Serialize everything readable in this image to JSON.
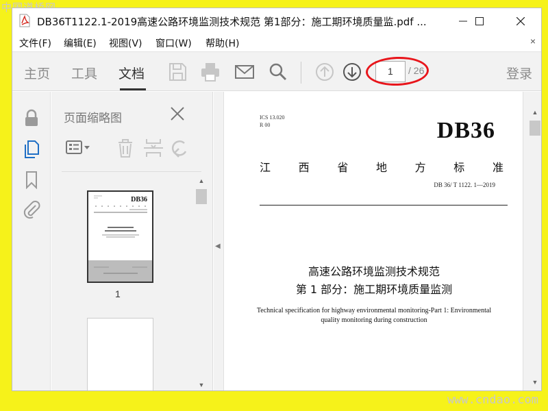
{
  "watermarks": {
    "top_left": "中国道桥网",
    "bottom_right": "www.cndao.com"
  },
  "window": {
    "title": "DB36T1122.1-2019高速公路环境监测技术规范 第1部分：施工期环境质量监.pdf ..."
  },
  "menu": {
    "items": [
      {
        "label": "文件(F)"
      },
      {
        "label": "编辑(E)"
      },
      {
        "label": "视图(V)"
      },
      {
        "label": "窗口(W)"
      },
      {
        "label": "帮助(H)"
      }
    ],
    "close": "×"
  },
  "toolbar": {
    "tabs": [
      {
        "label": "主页",
        "active": false
      },
      {
        "label": "工具",
        "active": false
      },
      {
        "label": "文档",
        "active": true
      }
    ],
    "icons": [
      "save-icon",
      "print-icon",
      "email-icon",
      "search-icon",
      "page-up-icon",
      "page-down-icon"
    ],
    "page_current": "1",
    "page_total": "/ 26",
    "login": "登录",
    "annotation_color": "#e8151b"
  },
  "left_rail": {
    "icons": [
      "lock-icon",
      "page-thumbnails-icon",
      "bookmark-icon",
      "attachment-icon"
    ]
  },
  "thumbnail_panel": {
    "title": "页面缩略图",
    "icons": [
      "options-menu-icon",
      "delete-icon",
      "extract-icon",
      "rotate-icon"
    ],
    "thumbnails": [
      {
        "label": "1"
      }
    ],
    "thumb_code": "DB36"
  },
  "document": {
    "ics": "ICS 13.020",
    "category": "R 00",
    "code": "DB36",
    "province_chars": [
      "江",
      "西",
      "省",
      "地",
      "方",
      "标",
      "准"
    ],
    "standard_number": "DB 36/ T 1122. 1—2019",
    "title_cn_line1": "高速公路环境监测技术规范",
    "title_cn_line2": "第 1 部分：施工期环境质量监测",
    "title_en": "Technical specification for highway environmental monitoring-Part 1: Environmental quality monitoring during construction"
  }
}
